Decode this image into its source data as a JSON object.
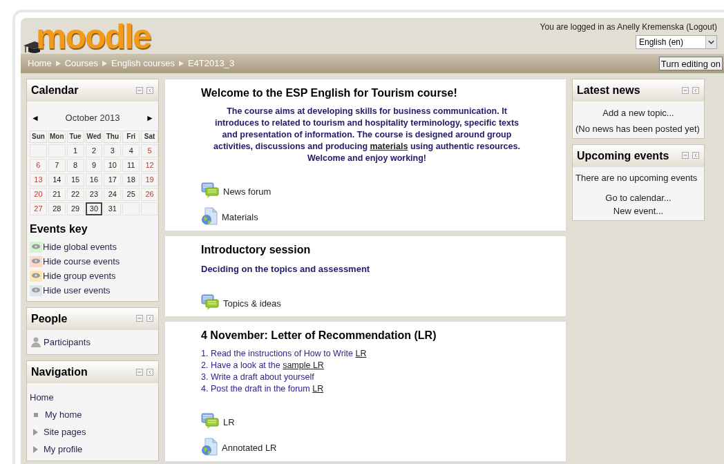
{
  "header": {
    "logo": "moodle",
    "login_text": "You are logged in as ",
    "user": "Anelly Kremenska",
    "logout": "(Logout)",
    "language": "English (en)"
  },
  "breadcrumb": [
    "Home",
    "Courses",
    "English courses",
    "E4T2013_3"
  ],
  "edit_button": "Turn editing on",
  "calendar": {
    "title": "Calendar",
    "prev": "◄",
    "month": "October 2013",
    "next": "►",
    "weekdays": [
      "Sun",
      "Mon",
      "Tue",
      "Wed",
      "Thu",
      "Fri",
      "Sat"
    ],
    "weeks": [
      [
        {
          "kind": "empty"
        },
        {
          "kind": "empty"
        },
        {
          "kind": "day",
          "day": "1",
          "weekend": false,
          "today": false
        },
        {
          "day": "2",
          "weekend": false,
          "today": false
        },
        {
          "day": "3",
          "weekend": false,
          "today": false
        },
        {
          "day": "4",
          "weekend": false,
          "today": false
        },
        {
          "day": "5",
          "weekend": true,
          "today": false
        }
      ],
      [
        {
          "day": "6",
          "weekend": true,
          "today": false
        },
        {
          "day": "7",
          "weekend": false,
          "today": false
        },
        {
          "day": "8",
          "weekend": false,
          "today": false
        },
        {
          "day": "9",
          "weekend": false,
          "today": false
        },
        {
          "day": "10",
          "weekend": false,
          "today": false
        },
        {
          "day": "11",
          "weekend": false,
          "today": false
        },
        {
          "day": "12",
          "weekend": true,
          "today": false
        }
      ],
      [
        {
          "day": "13",
          "weekend": true,
          "today": false
        },
        {
          "day": "14",
          "weekend": false,
          "today": false
        },
        {
          "day": "15",
          "weekend": false,
          "today": false
        },
        {
          "day": "16",
          "weekend": false,
          "today": false
        },
        {
          "day": "17",
          "weekend": false,
          "today": false
        },
        {
          "day": "18",
          "weekend": false,
          "today": false
        },
        {
          "day": "19",
          "weekend": true,
          "today": false
        }
      ],
      [
        {
          "day": "20",
          "weekend": true,
          "today": false
        },
        {
          "day": "21",
          "weekend": false,
          "today": false
        },
        {
          "day": "22",
          "weekend": false,
          "today": false
        },
        {
          "day": "23",
          "weekend": false,
          "today": false
        },
        {
          "day": "24",
          "weekend": false,
          "today": false
        },
        {
          "day": "25",
          "weekend": false,
          "today": false
        },
        {
          "day": "26",
          "weekend": true,
          "today": false
        }
      ],
      [
        {
          "day": "27",
          "weekend": true,
          "today": false
        },
        {
          "day": "28",
          "weekend": false,
          "today": false
        },
        {
          "day": "29",
          "weekend": false,
          "today": false
        },
        {
          "day": "30",
          "weekend": false,
          "today": true
        },
        {
          "day": "31",
          "weekend": false,
          "today": false
        },
        {
          "kind": "empty"
        },
        {
          "kind": "empty"
        }
      ]
    ],
    "events_key_title": "Events key",
    "events_key": [
      {
        "label": "Hide global events",
        "color": "#d3f3d1"
      },
      {
        "label": "Hide course events",
        "color": "#fdd7c8"
      },
      {
        "label": "Hide group events",
        "color": "#fde4b0"
      },
      {
        "label": "Hide user events",
        "color": "#dce7ec"
      }
    ]
  },
  "people": {
    "title": "People",
    "items": [
      "Participants"
    ]
  },
  "navigation": {
    "title": "Navigation",
    "items": [
      {
        "kind": "plain",
        "label": "Home"
      },
      {
        "kind": "bullet",
        "label": "My home"
      },
      {
        "kind": "expander",
        "label": "Site pages"
      },
      {
        "kind": "expander",
        "label": "My profile"
      }
    ]
  },
  "sections": [
    {
      "title": "Welcome to the ESP English for Tourism course!",
      "kind": "summary",
      "lines": [
        [
          {
            "text": "The course aims at developing skills for business communication. It introduces to related to tourism and hospitality terminology, specific texts and presentation of information. The course is designed around group activities, discussions and producing ",
            "link": false
          },
          {
            "text": "materials",
            "link": true
          },
          {
            "text": " using authentic resources. Welcome and enjoy working!",
            "link": false
          }
        ]
      ],
      "activities": [
        {
          "kind": "forum",
          "label": "News forum"
        },
        {
          "kind": "resource",
          "label": "Materials"
        }
      ]
    },
    {
      "title": "Introductory session",
      "kind": "subtitle",
      "lines": [
        [
          {
            "text": "Deciding on the topics and assessment",
            "link": false
          }
        ]
      ],
      "activities": [
        {
          "kind": "forum",
          "label": "Topics & ideas"
        }
      ]
    },
    {
      "title": "4 November: Letter of Recommendation (LR)",
      "kind": "list",
      "lines": [
        [
          {
            "text": "1. Read the instructions of How to Write  ",
            "link": false
          },
          {
            "text": "LR",
            "link": true
          }
        ],
        [
          {
            "text": "2. Have a look at the ",
            "link": false
          },
          {
            "text": "sample LR",
            "link": true
          }
        ],
        [
          {
            "text": "3. Write a draft about yourself",
            "link": false
          }
        ],
        [
          {
            "text": "4. Post the draft in the forum ",
            "link": false
          },
          {
            "text": "LR",
            "link": true
          }
        ]
      ],
      "activities": [
        {
          "kind": "forum",
          "label": "LR"
        },
        {
          "kind": "resource",
          "label": "Annotated LR"
        }
      ]
    }
  ],
  "latest_news": {
    "title": "Latest news",
    "add": "Add a new topic...",
    "empty": "(No news has been posted yet)"
  },
  "upcoming": {
    "title": "Upcoming events",
    "empty": "There are no upcoming events",
    "links": [
      "Go to calendar...",
      "New event..."
    ]
  }
}
